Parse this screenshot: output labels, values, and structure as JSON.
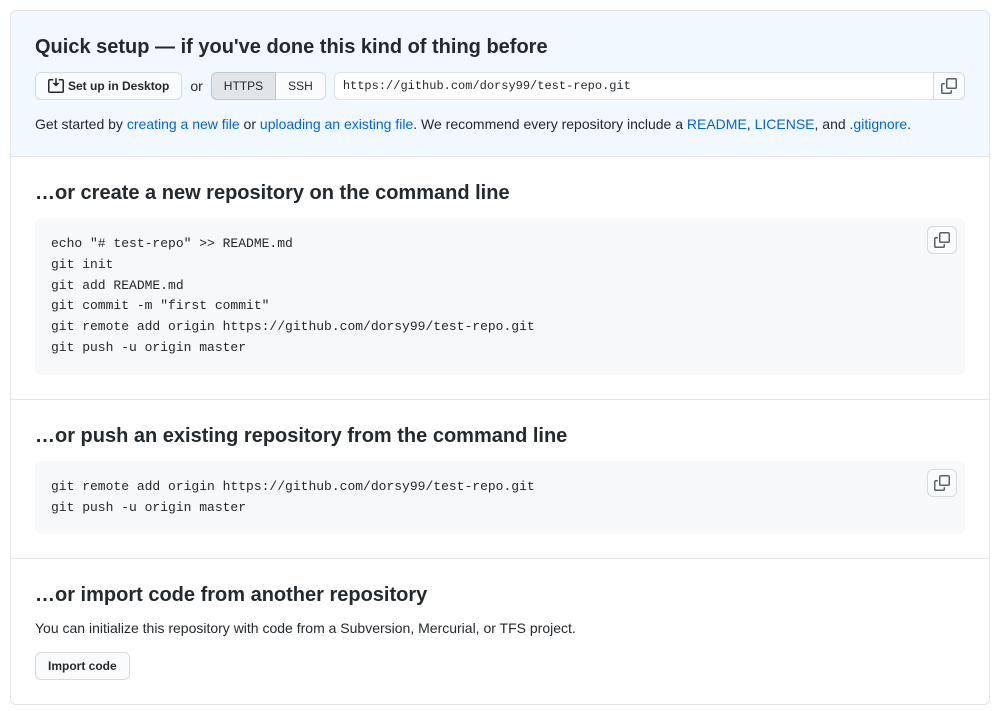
{
  "quickSetup": {
    "title": "Quick setup — if you've done this kind of thing before",
    "desktopBtn": "Set up in Desktop",
    "orText": "or",
    "httpsLabel": "HTTPS",
    "sshLabel": "SSH",
    "repoUrl": "https://github.com/dorsy99/test-repo.git",
    "help": {
      "prefix": "Get started by ",
      "createFile": "creating a new file",
      "or": " or ",
      "uploadFile": "uploading an existing file",
      "middle": ". We recommend every repository include a ",
      "readme": "README",
      "comma": ", ",
      "license": "LICENSE",
      "and": ", and .",
      "gitignore": "gitignore",
      "end": "."
    }
  },
  "newRepo": {
    "title": "…or create a new repository on the command line",
    "code": "echo \"# test-repo\" >> README.md\ngit init\ngit add README.md\ngit commit -m \"first commit\"\ngit remote add origin https://github.com/dorsy99/test-repo.git\ngit push -u origin master"
  },
  "pushExisting": {
    "title": "…or push an existing repository from the command line",
    "code": "git remote add origin https://github.com/dorsy99/test-repo.git\ngit push -u origin master"
  },
  "importCode": {
    "title": "…or import code from another repository",
    "desc": "You can initialize this repository with code from a Subversion, Mercurial, or TFS project.",
    "btn": "Import code"
  }
}
